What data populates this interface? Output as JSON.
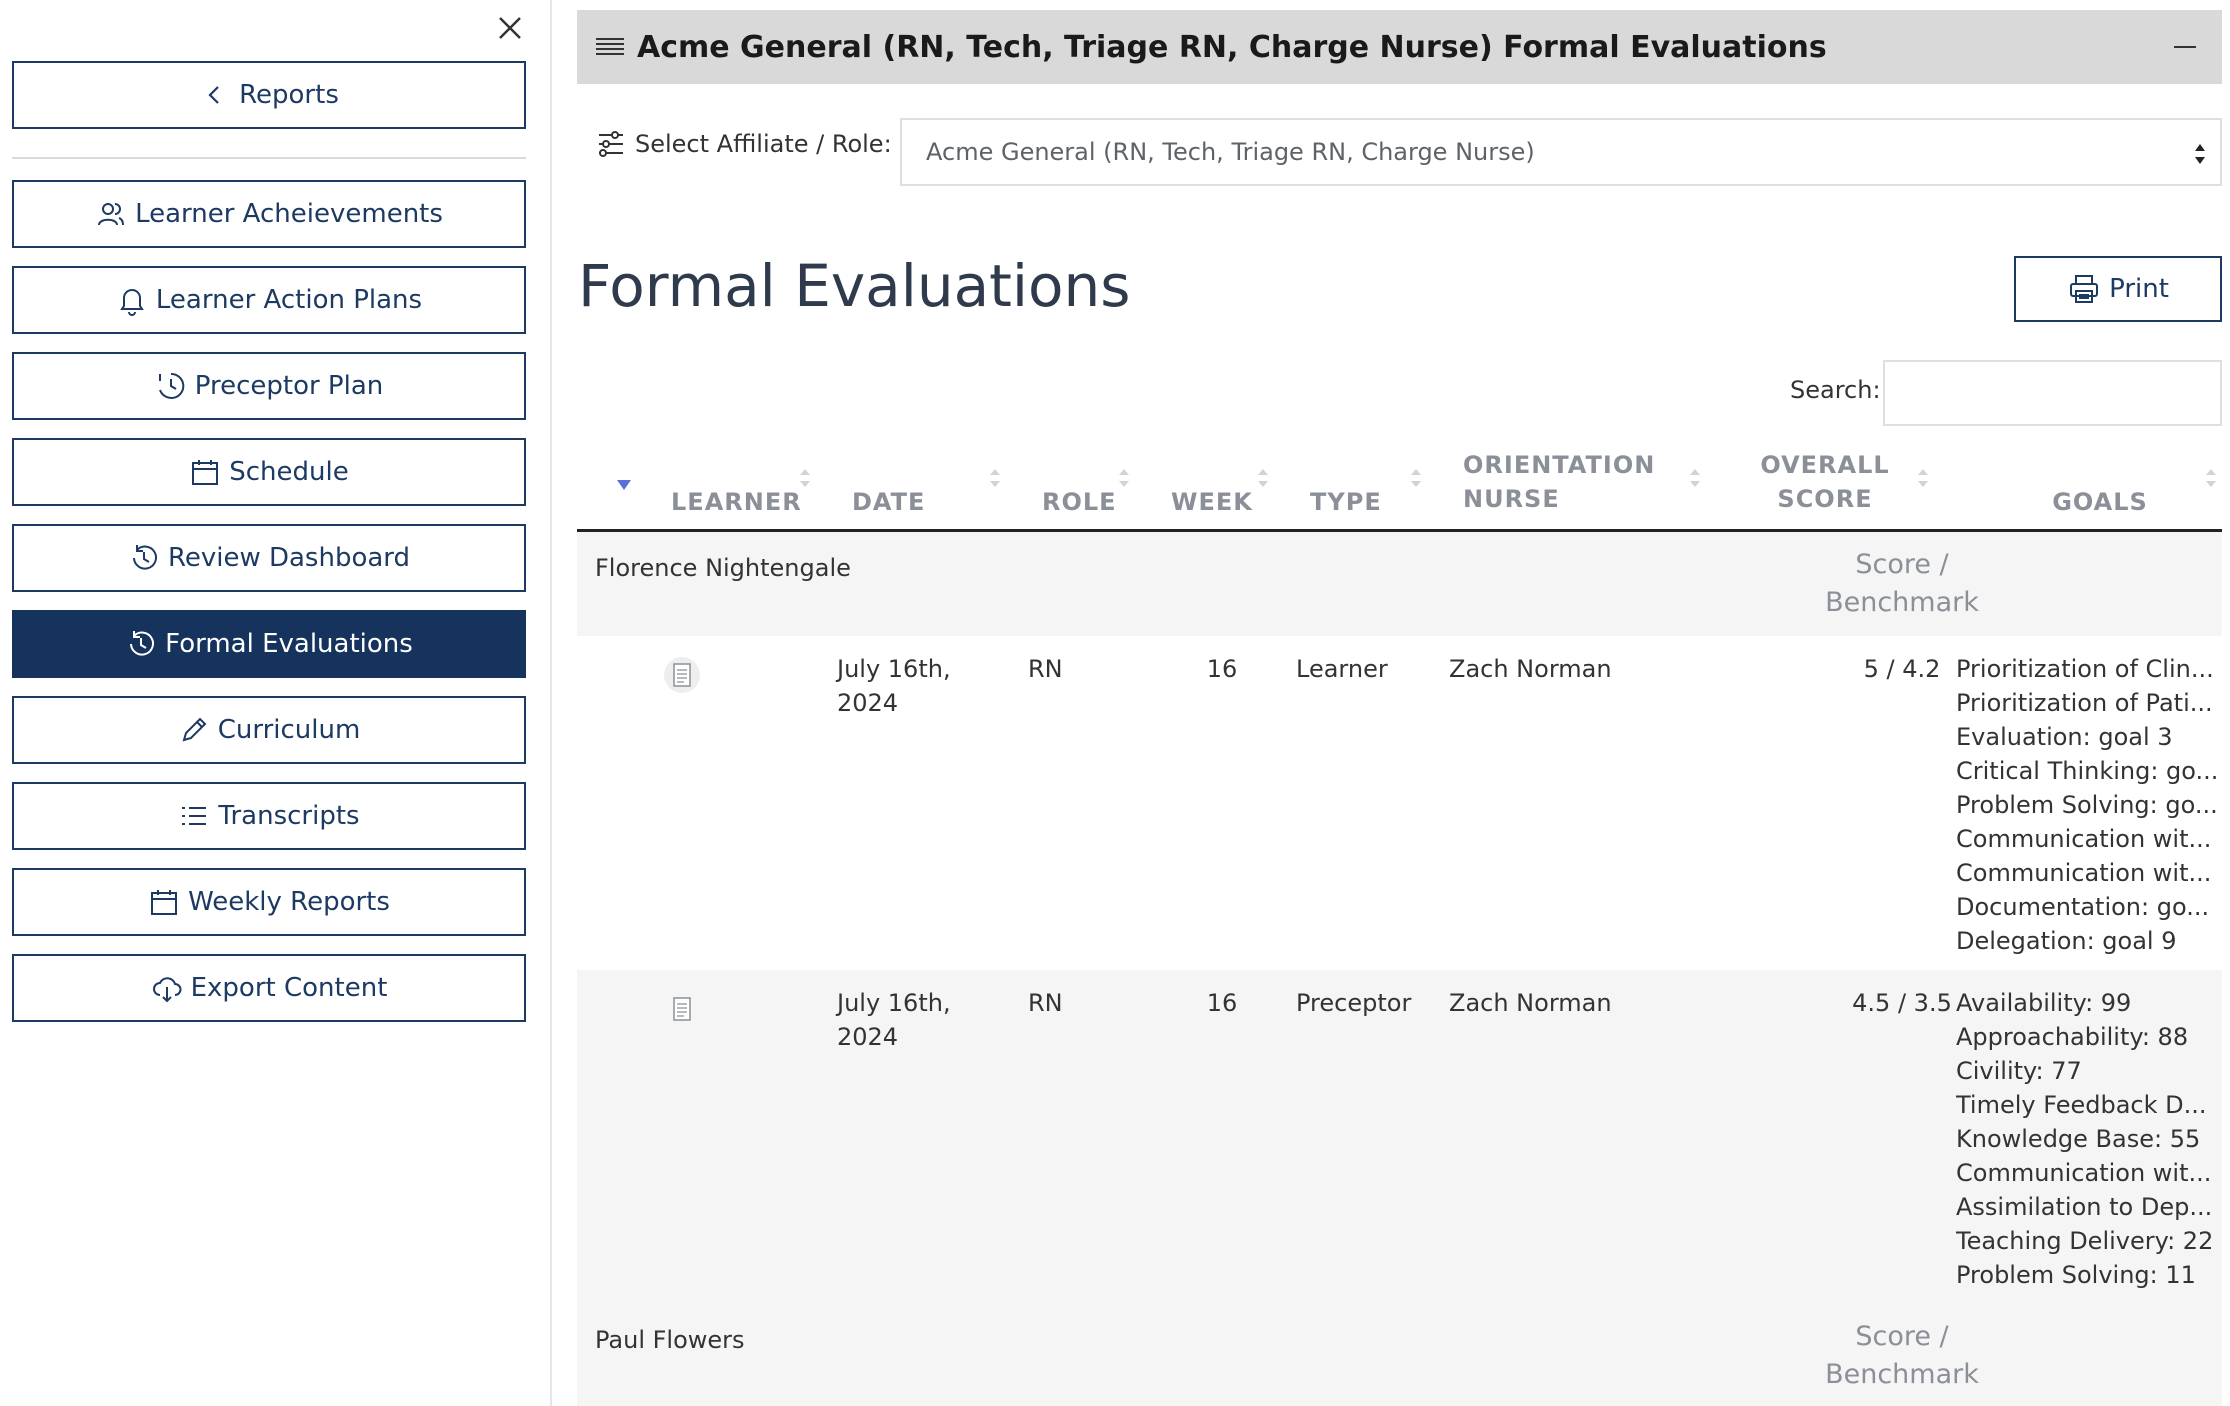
{
  "sidebar": {
    "reports_label": "Reports",
    "items": [
      {
        "label": "Learner Acheievements"
      },
      {
        "label": "Learner Action Plans"
      },
      {
        "label": "Preceptor Plan"
      },
      {
        "label": "Schedule"
      },
      {
        "label": "Review Dashboard"
      },
      {
        "label": "Formal Evaluations"
      },
      {
        "label": "Curriculum"
      },
      {
        "label": "Transcripts"
      },
      {
        "label": "Weekly Reports"
      },
      {
        "label": "Export Content"
      }
    ],
    "active_item": "Formal Evaluations"
  },
  "panel": {
    "title": "Acme General (RN, Tech, Triage RN, Charge Nurse) Formal Evaluations"
  },
  "filter": {
    "label": "Select Affiliate / Role:",
    "selected": "Acme General (RN, Tech, Triage RN, Charge Nurse)"
  },
  "main": {
    "title": "Formal Evaluations",
    "print_label": "Print",
    "search_label": "Search:",
    "search_value": ""
  },
  "table": {
    "headers": {
      "learner": "LEARNER",
      "date": "DATE",
      "role": "ROLE",
      "week": "WEEK",
      "type": "TYPE",
      "orientation_1": "ORIENTATION",
      "orientation_2": "NURSE",
      "overall_1": "OVERALL",
      "overall_2": "SCORE",
      "goals": "GOALS"
    },
    "groups": [
      {
        "name": "Florence Nightengale",
        "score_label_1": "Score /",
        "score_label_2": "Benchmark",
        "rows": [
          {
            "date_1": "July 16th,",
            "date_2": "2024",
            "role": "RN",
            "week": "16",
            "type": "Learner",
            "orientation_nurse": "Zach Norman",
            "overall_score": "5 / 4.2",
            "goals": [
              "Prioritization of Clin...",
              "Prioritization of Pati...",
              "Evaluation: goal 3",
              "Critical Thinking: go...",
              "Problem Solving: go...",
              "Communication wit...",
              "Communication wit...",
              "Documentation: go...",
              "Delegation: goal 9"
            ]
          },
          {
            "date_1": "July 16th,",
            "date_2": "2024",
            "role": "RN",
            "week": "16",
            "type": "Preceptor",
            "orientation_nurse": "Zach Norman",
            "overall_score": "4.5 / 3.5",
            "goals": [
              "Availability: 99",
              "Approachability: 88",
              "Civility: 77",
              "Timely Feedback D...",
              "Knowledge Base: 55",
              "Communication wit...",
              "Assimilation to Dep...",
              "Teaching Delivery: 22",
              "Problem Solving: 11"
            ]
          }
        ]
      },
      {
        "name": "Paul Flowers",
        "score_label_1": "Score /",
        "score_label_2": "Benchmark",
        "rows": []
      }
    ]
  },
  "colors": {
    "navy": "#15335c",
    "border_navy": "#1d3a63",
    "header_gray": "#d9d9d9",
    "row_alt": "#f5f5f5",
    "sort_active": "#5b6fd6"
  }
}
